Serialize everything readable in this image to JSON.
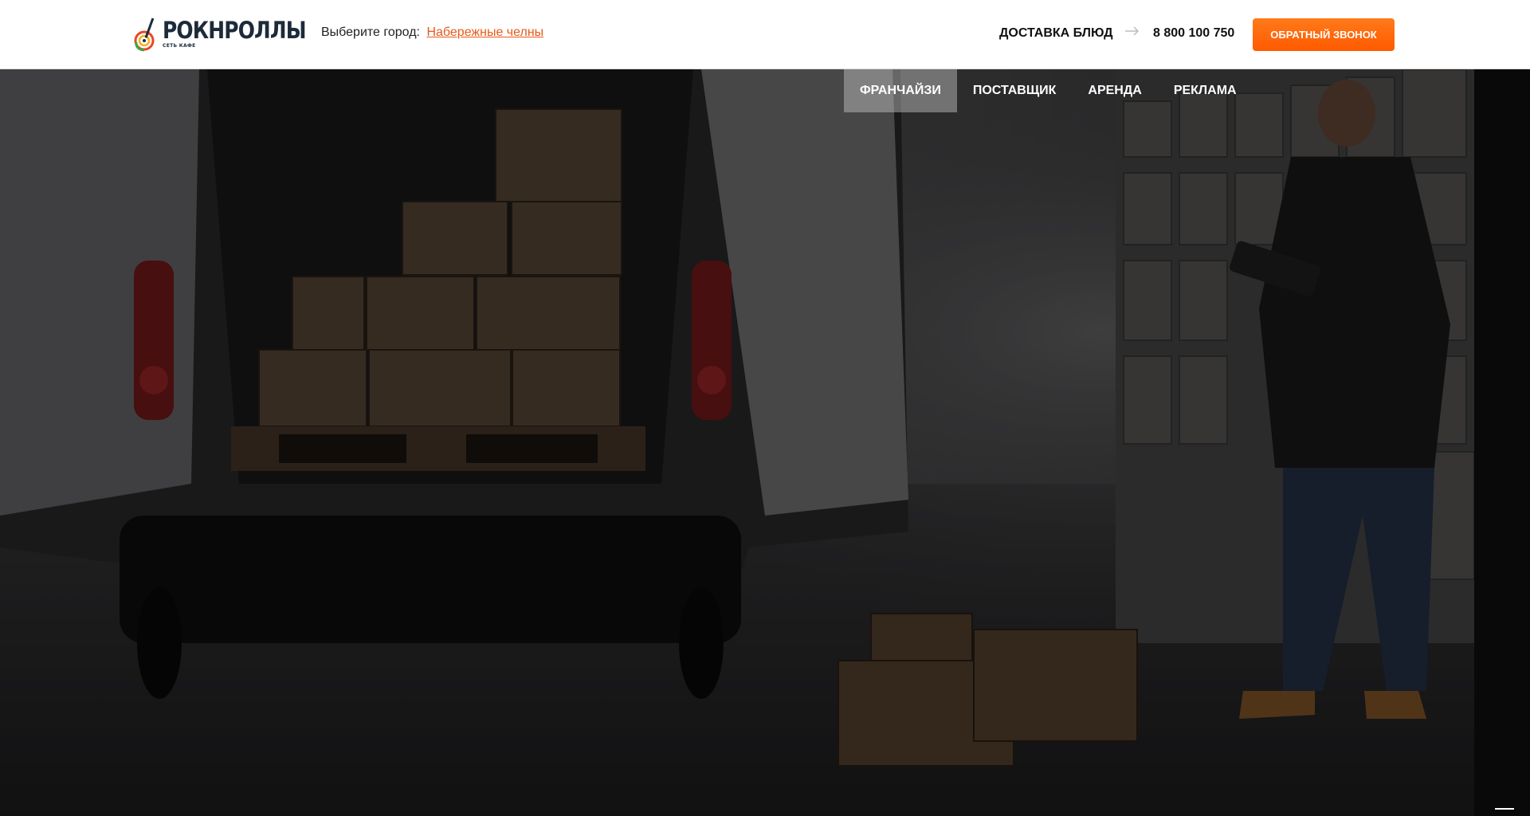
{
  "logo": {
    "name": "РОКНРОЛЛЫ",
    "subtitle": "СЕТЬ КАФЕ"
  },
  "city": {
    "label": "Выберите город:",
    "value": "Набережные челны"
  },
  "header": {
    "delivery": "ДОСТАВКА БЛЮД",
    "phone": "8 800 100 750",
    "callback": "ОБРАТНЫЙ ЗВОНОК"
  },
  "subnav": {
    "tabs": [
      {
        "label": "ФРАНЧАЙЗИ",
        "active": true
      },
      {
        "label": "ПОСТАВЩИК",
        "active": false
      },
      {
        "label": "АРЕНДА",
        "active": false
      },
      {
        "label": "РЕКЛАМА",
        "active": false
      }
    ]
  },
  "colors": {
    "accent": "#ff6a00",
    "link": "#e8591a",
    "brand_dark": "#1d2a3a"
  },
  "icons": [
    "logo-guitar-icon",
    "arrow-right-icon",
    "hamburger-menu-icon"
  ]
}
